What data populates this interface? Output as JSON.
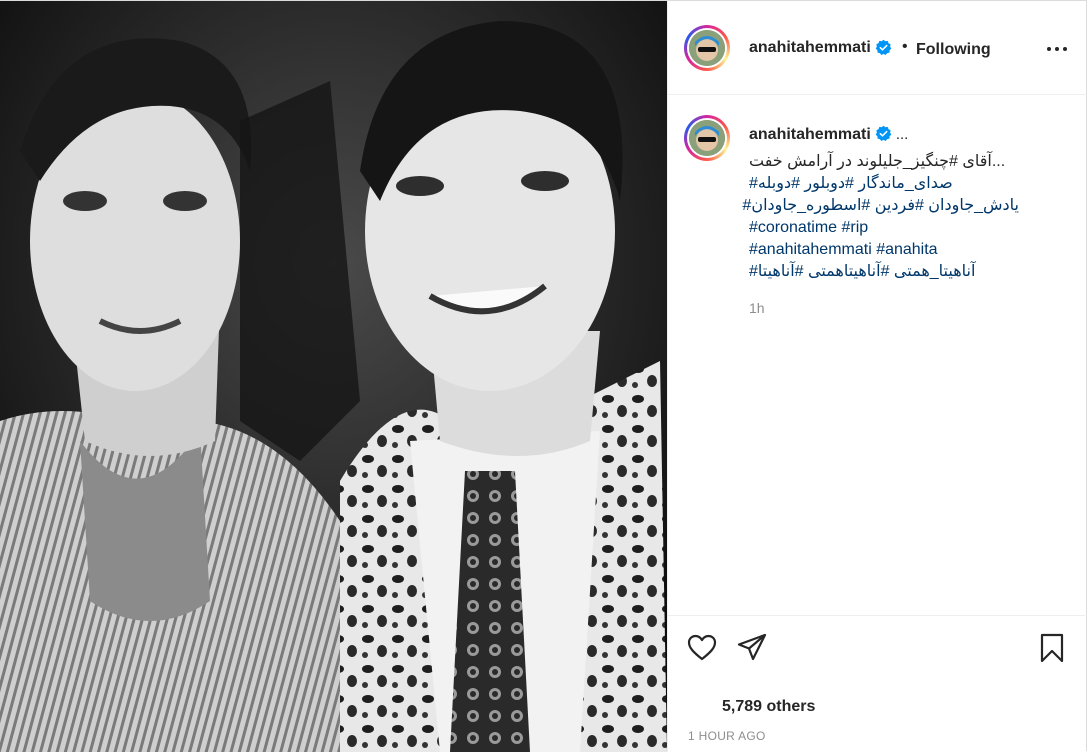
{
  "post": {
    "username": "anahitahemmati",
    "separator": "•",
    "follow_status": "Following",
    "caption": {
      "ellipsis": "...",
      "lines": [
        "...آقای #چنگیز_جلیلوند در آرامش خفت",
        "صدای_ماندگار #دوبلور #دوبله#",
        "یادش_جاودان #فردین #اسطوره_جاودان#",
        "#coronatime #rip",
        "#anahitahemmati #anahita",
        "آناهیتا_همتی #آناهیتاهمتی #آناهیتا#"
      ]
    },
    "relative_time": "1h",
    "likes_text": "5,789 others",
    "date_text": "1 HOUR AGO"
  },
  "icons": {
    "verified": "verified-badge-icon",
    "more": "more-options-icon",
    "like": "heart-icon",
    "share": "paper-plane-icon",
    "save": "bookmark-icon"
  },
  "colors": {
    "hashtag": "#00376b",
    "verified": "#0095f6",
    "muted": "#8e8e8e"
  }
}
